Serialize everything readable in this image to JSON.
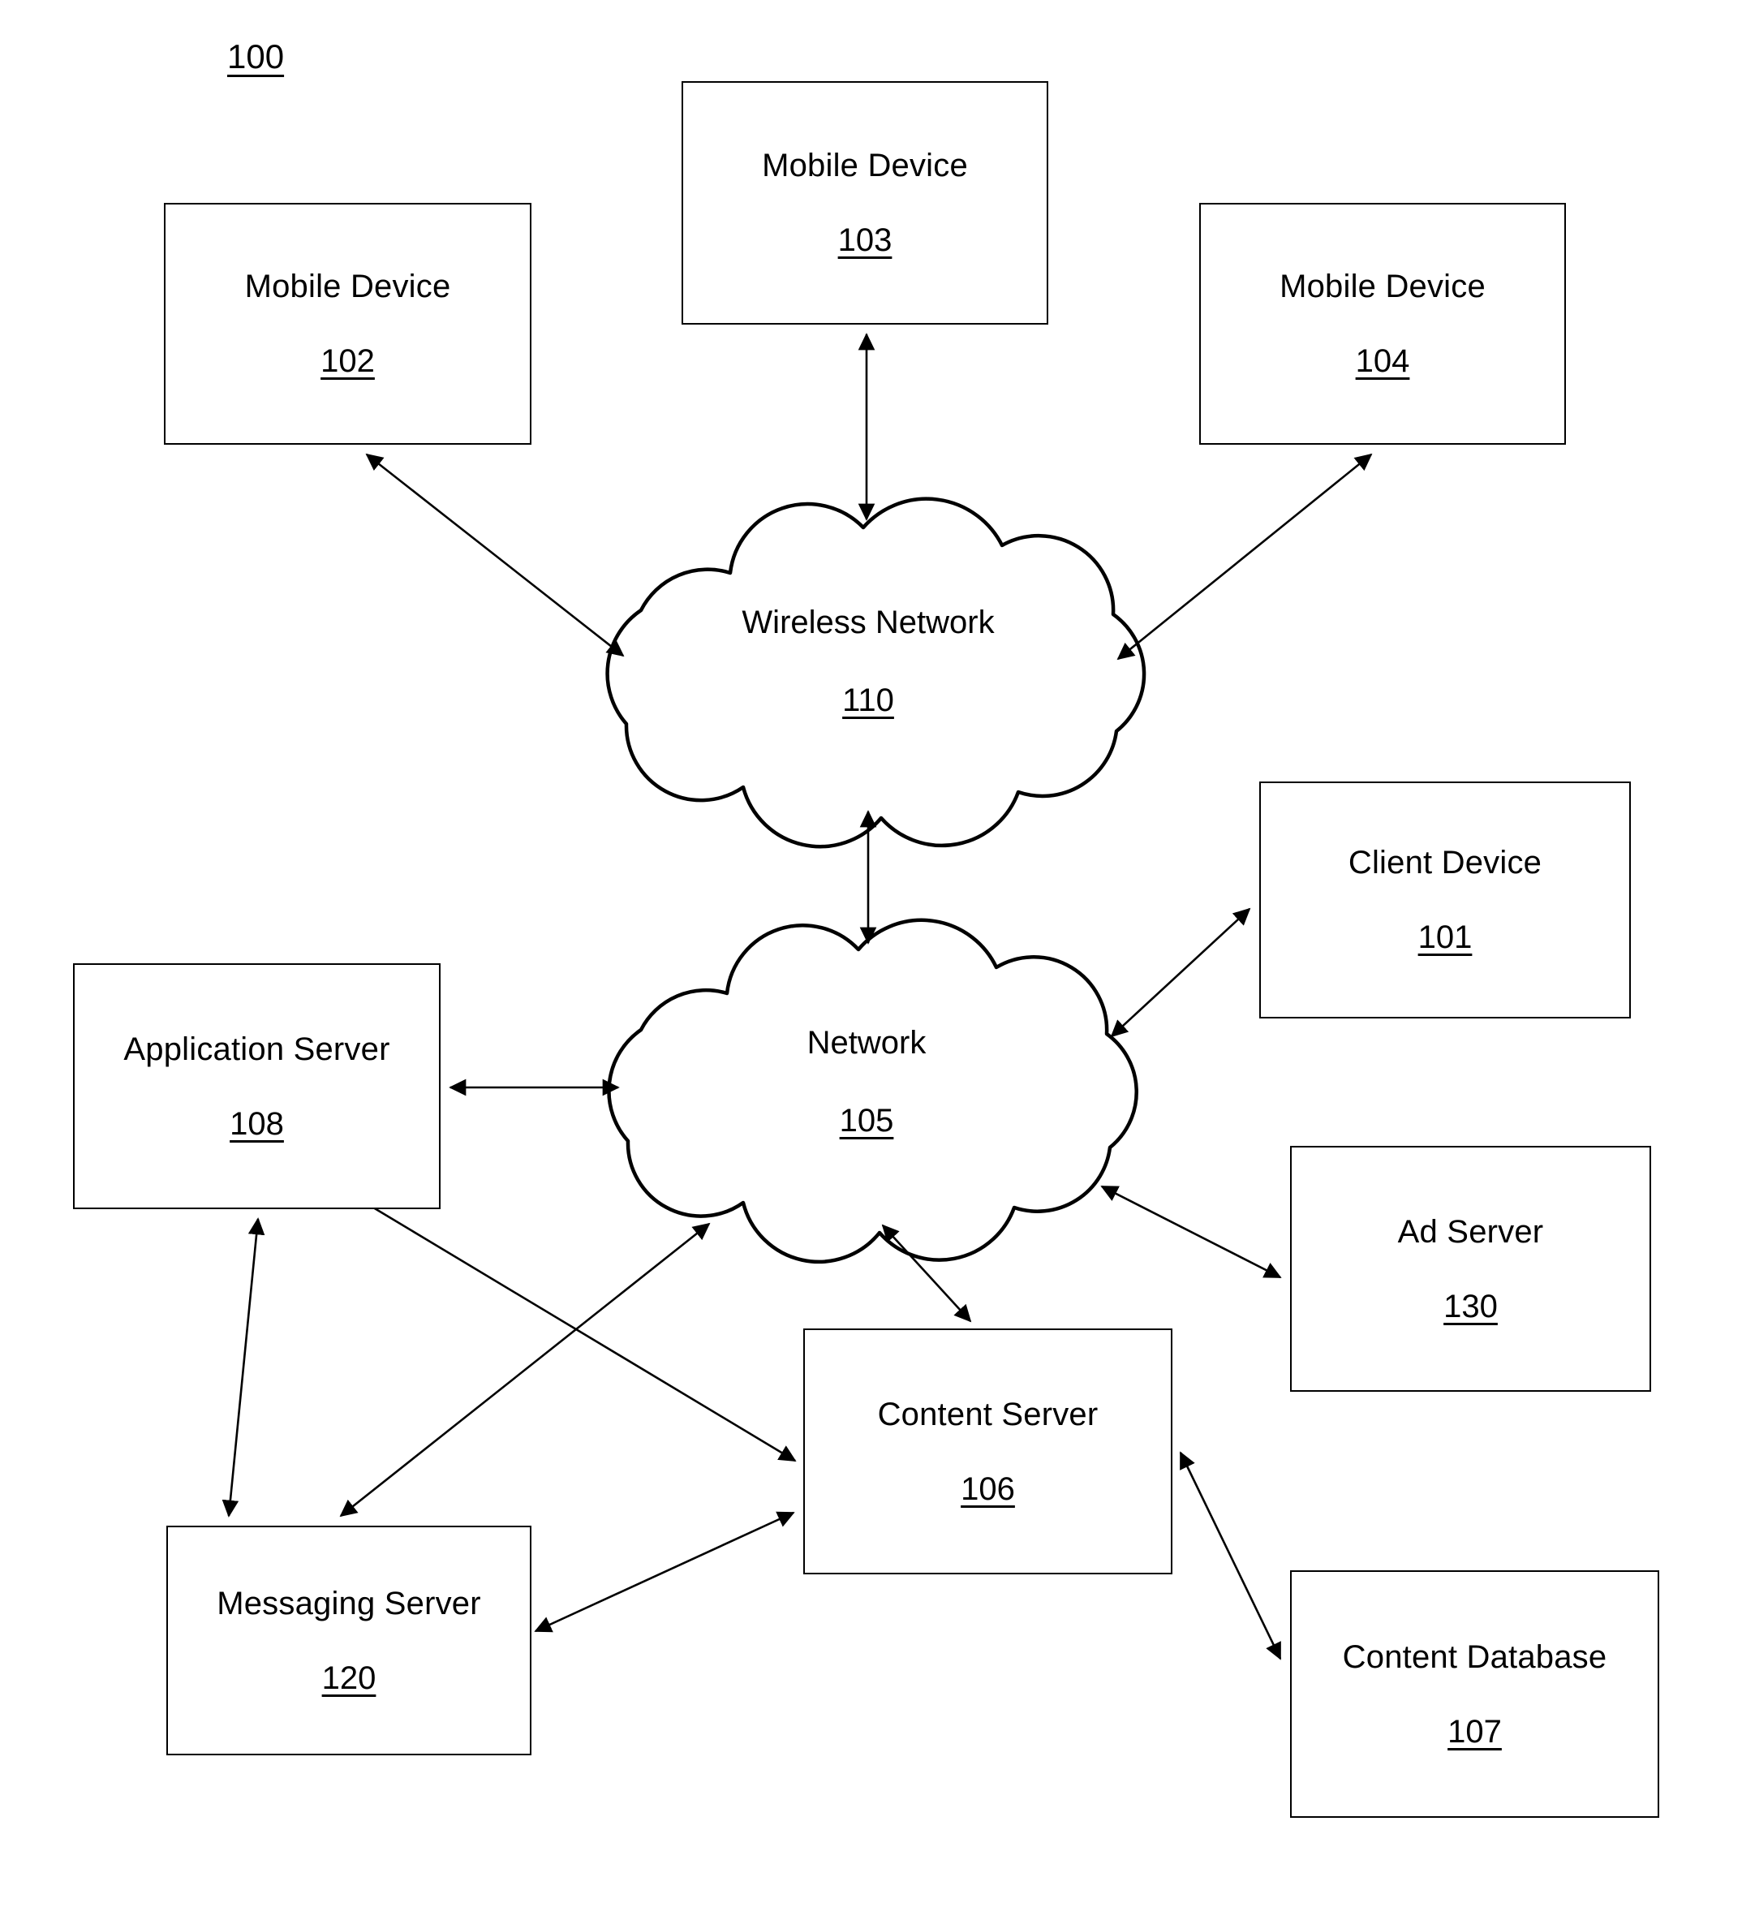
{
  "figure": {
    "number": "100",
    "kind": "system-architecture-diagram"
  },
  "colors": {
    "stroke": "#000000",
    "fill": "#ffffff",
    "background": "#ffffff"
  },
  "nodes": {
    "mobile_device_102": {
      "label": "Mobile Device",
      "ref": "102",
      "shape": "rectangle"
    },
    "mobile_device_103": {
      "label": "Mobile Device",
      "ref": "103",
      "shape": "rectangle"
    },
    "mobile_device_104": {
      "label": "Mobile Device",
      "ref": "104",
      "shape": "rectangle"
    },
    "wireless_network_110": {
      "label": "Wireless Network",
      "ref": "110",
      "shape": "cloud"
    },
    "network_105": {
      "label": "Network",
      "ref": "105",
      "shape": "cloud"
    },
    "client_device_101": {
      "label": "Client Device",
      "ref": "101",
      "shape": "rectangle"
    },
    "application_server_108": {
      "label": "Application Server",
      "ref": "108",
      "shape": "rectangle"
    },
    "ad_server_130": {
      "label": "Ad Server",
      "ref": "130",
      "shape": "rectangle"
    },
    "content_server_106": {
      "label": "Content Server",
      "ref": "106",
      "shape": "rectangle"
    },
    "messaging_server_120": {
      "label": "Messaging Server",
      "ref": "120",
      "shape": "rectangle"
    },
    "content_database_107": {
      "label": "Content Database",
      "ref": "107",
      "shape": "rectangle"
    }
  },
  "connections": [
    {
      "from": "mobile_device_102",
      "to": "wireless_network_110",
      "arrow": "double"
    },
    {
      "from": "mobile_device_103",
      "to": "wireless_network_110",
      "arrow": "double"
    },
    {
      "from": "mobile_device_104",
      "to": "wireless_network_110",
      "arrow": "double"
    },
    {
      "from": "wireless_network_110",
      "to": "network_105",
      "arrow": "double"
    },
    {
      "from": "network_105",
      "to": "client_device_101",
      "arrow": "double"
    },
    {
      "from": "network_105",
      "to": "application_server_108",
      "arrow": "double"
    },
    {
      "from": "network_105",
      "to": "ad_server_130",
      "arrow": "double"
    },
    {
      "from": "network_105",
      "to": "content_server_106",
      "arrow": "double"
    },
    {
      "from": "network_105",
      "to": "messaging_server_120",
      "arrow": "double"
    },
    {
      "from": "application_server_108",
      "to": "messaging_server_120",
      "arrow": "double"
    },
    {
      "from": "application_server_108",
      "to": "content_server_106",
      "arrow": "double"
    },
    {
      "from": "messaging_server_120",
      "to": "content_server_106",
      "arrow": "double"
    },
    {
      "from": "content_server_106",
      "to": "content_database_107",
      "arrow": "double"
    }
  ]
}
